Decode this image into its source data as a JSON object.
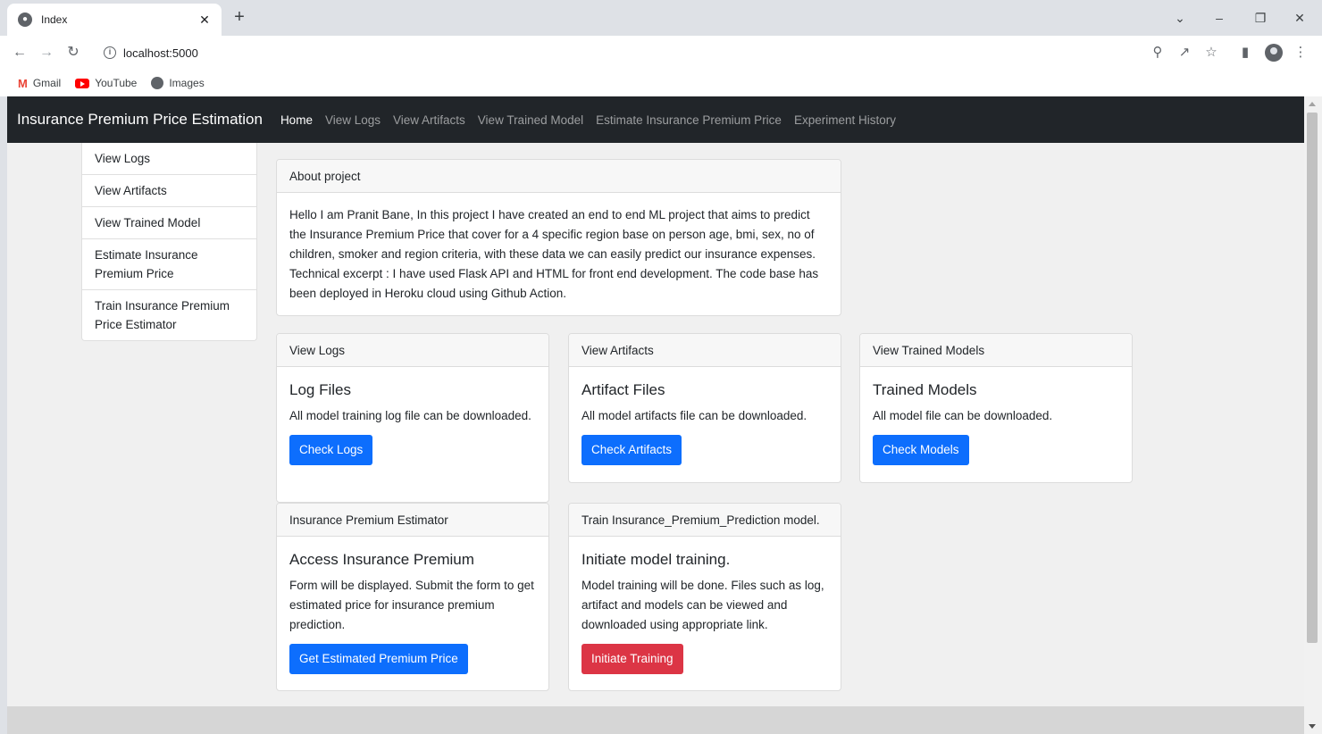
{
  "browser": {
    "tab_title": "Index",
    "url": "localhost:5000",
    "bookmarks": [
      "Gmail",
      "YouTube",
      "Images"
    ]
  },
  "navbar": {
    "brand": "Insurance Premium Price Estimation",
    "links": [
      "Home",
      "View Logs",
      "View Artifacts",
      "View Trained Model",
      "Estimate Insurance Premium Price",
      "Experiment History"
    ]
  },
  "sidebar": {
    "items": [
      "View Logs",
      "View Artifacts",
      "View Trained Model",
      "Estimate Insurance Premium Price",
      "Train Insurance Premium Price Estimator"
    ]
  },
  "about": {
    "header": "About project",
    "text": "Hello I am Pranit Bane, In this project I have created an end to end ML project that aims to predict the Insurance Premium Price that cover for a 4 specific region base on person age, bmi, sex, no of children, smoker and region criteria, with these data we can easily predict our insurance expenses. Technical excerpt : I have used Flask API and HTML for front end development. The code base has been deployed in Heroku cloud using Github Action."
  },
  "cards": {
    "logs": {
      "header": "View Logs",
      "title": "Log Files",
      "text": "All model training log file can be downloaded.",
      "button": "Check Logs"
    },
    "artifacts": {
      "header": "View Artifacts",
      "title": "Artifact Files",
      "text": "All model artifacts file can be downloaded.",
      "button": "Check Artifacts"
    },
    "models": {
      "header": "View Trained Models",
      "title": "Trained Models",
      "text": "All model file can be downloaded.",
      "button": "Check Models"
    },
    "estimator": {
      "header": "Insurance Premium Estimator",
      "title": "Access Insurance Premium",
      "text": "Form will be displayed. Submit the form to get estimated price for insurance premium prediction.",
      "button": "Get Estimated Premium Price"
    },
    "training": {
      "header": "Train Insurance_Premium_Prediction model.",
      "title": "Initiate model training.",
      "text": "Model training will be done. Files such as log, artifact and models can be viewed and downloaded using appropriate link.",
      "button": "Initiate Training"
    }
  },
  "colors": {
    "navbar_bg": "#212529",
    "primary": "#0d6efd",
    "danger": "#dc3545"
  }
}
